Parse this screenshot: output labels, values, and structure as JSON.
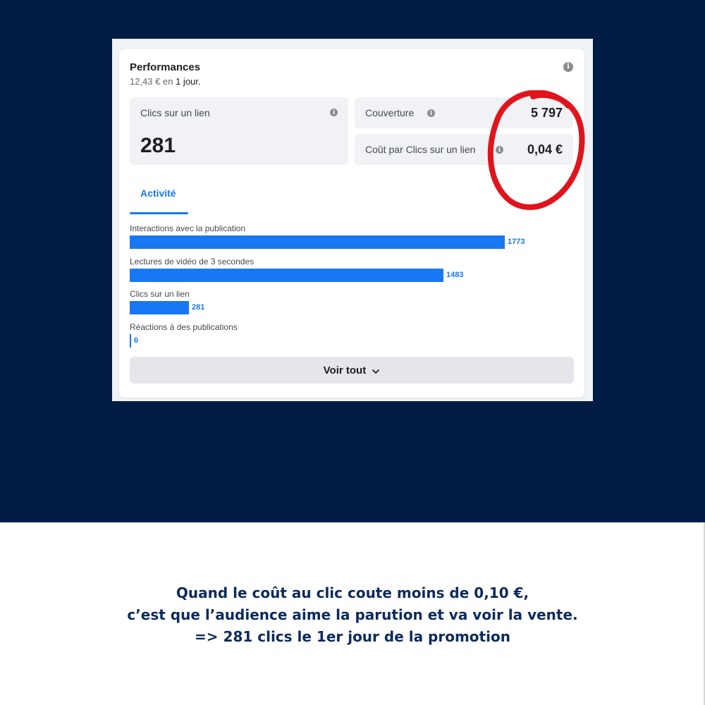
{
  "performance": {
    "title": "Performances",
    "spend_amount": "12,43 €",
    "spend_connector": "en",
    "spend_period": "1 jour."
  },
  "metrics": {
    "link_clicks": {
      "label": "Clics sur un lien",
      "value": "281"
    },
    "reach": {
      "label": "Couverture",
      "value": "5 797"
    },
    "cost_per_click": {
      "label": "Coût par Clics sur un lien",
      "value": "0,04 €"
    }
  },
  "tabs": {
    "activity": "Activité"
  },
  "activity": [
    {
      "label": "Interactions avec la publication",
      "value": 1773
    },
    {
      "label": "Lectures de vidéo de 3 secondes",
      "value": 1483
    },
    {
      "label": "Clics sur un lien",
      "value": 281
    },
    {
      "label": "Réactions à des publications",
      "value": 6
    }
  ],
  "see_all": {
    "label": "Voir tout",
    "icon": "chevron-down-icon"
  },
  "caption": {
    "line1": "Quand le coût au clic coute moins de 0,10 €,",
    "line2": "c’est que l’audience aime la parution et va voir la vente.",
    "line3": "=> 281 clics le 1er jour de la promotion"
  },
  "colors": {
    "background_dark": "#001c44",
    "accent_blue": "#1877f2",
    "highlight_red": "#e0151c",
    "caption_text": "#0d2a5c"
  }
}
